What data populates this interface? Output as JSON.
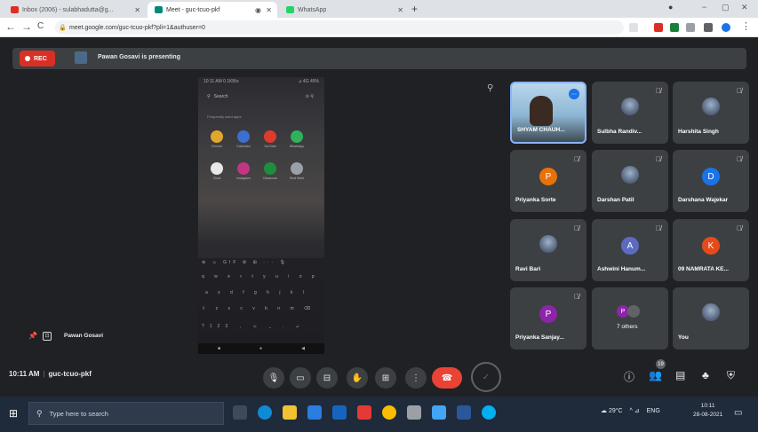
{
  "browser": {
    "tabs": [
      {
        "title": "Inbox (2006) - sulabhadutta@g...",
        "favicon_color": "#d93025"
      },
      {
        "title": "Meet - guc-tcuo-pkf",
        "favicon_color": "#00897b"
      },
      {
        "title": "WhatsApp",
        "favicon_color": "#25d366"
      }
    ],
    "tab_close": "✕",
    "tab_indicator": "◉",
    "new_tab": "+",
    "window_controls": {
      "minimize": "−",
      "restore": "▢",
      "close": "✕"
    },
    "profile": "●",
    "nav": {
      "back": "←",
      "forward": "→",
      "reload": "C"
    },
    "lock": "🔒",
    "url": "meet.google.com/guc-tcuo-pkf?pli=1&authuser=0",
    "extensions": [
      {
        "name": "star",
        "color": "#dee1e6"
      },
      {
        "name": "ext-red",
        "color": "#d93025"
      },
      {
        "name": "ext-check",
        "color": "#188038"
      },
      {
        "name": "ext-grid",
        "color": "#9aa0a6"
      },
      {
        "name": "ext-puzzle",
        "color": "#5f6368"
      },
      {
        "name": "ext-profile",
        "color": "#1a73e8"
      }
    ],
    "menu": "⋮"
  },
  "meet": {
    "rec_label": "REC",
    "presenting_text": "Pawan Gosavi is presenting",
    "pin_icon": "⚲",
    "shared_screen": {
      "status_left": "10:11 AM 0.1KB/s",
      "status_right": "⊿ 4G 45%",
      "search_placeholder": "Search",
      "search_icons": "⊙ ⚲",
      "section": "Frequently used apps",
      "apps_row1": [
        {
          "label": "Chrome",
          "color": "#e0a72a"
        },
        {
          "label": "Calculator",
          "color": "#3b6fd1"
        },
        {
          "label": "YouTube",
          "color": "#e03a2e"
        },
        {
          "label": "WhatsApp",
          "color": "#2fb25b"
        }
      ],
      "apps_row2": [
        {
          "label": "Clock",
          "color": "#e8e8e8"
        },
        {
          "label": "Instagram",
          "color": "#c13584"
        },
        {
          "label": "Classroom",
          "color": "#1e8e3e"
        },
        {
          "label": "Real Meet",
          "color": "#9aa0a6"
        }
      ],
      "keyboard_rows": [
        "q w e r t y u i o p",
        "a s d f g h j k l",
        "⇧ z x c v b n m ⌫",
        "?123 , ☺ ⎵ . ↵"
      ],
      "keyboard_top": "⊕ ☺ GIF ⚙ ⊞ ··· 🎙",
      "navbar": [
        "■",
        "●",
        "◀"
      ]
    },
    "tiles": [
      {
        "name": "SHYAM CHAUH...",
        "type": "camera",
        "muted": false,
        "more": "⋯"
      },
      {
        "name": "Sulbha Randiv...",
        "type": "photo",
        "muted": true
      },
      {
        "name": "Harshita Singh",
        "type": "photo",
        "muted": true
      },
      {
        "name": "Priyanka Sorte",
        "type": "letter",
        "initial": "P",
        "color": "#e8710a",
        "muted": true
      },
      {
        "name": "Darshan Patil",
        "type": "photo",
        "muted": true
      },
      {
        "name": "Darshana Wajekar",
        "type": "letter",
        "initial": "D",
        "color": "#1a73e8",
        "muted": true
      },
      {
        "name": "Ravi Bari",
        "type": "photo",
        "muted": true
      },
      {
        "name": "Ashwini Hanum...",
        "type": "letter",
        "initial": "A",
        "color": "#5c6bc0",
        "muted": true
      },
      {
        "name": "09 NAMRATA KE...",
        "type": "letter",
        "initial": "K",
        "color": "#e64a19",
        "muted": true
      },
      {
        "name": "Priyanka Sanjay...",
        "type": "letter",
        "initial": "P",
        "color": "#8e24aa",
        "muted": true
      },
      {
        "name": "7 others",
        "type": "others",
        "initial": "P",
        "color": "#8e24aa",
        "muted": false
      },
      {
        "name": "You",
        "type": "photo",
        "muted": false
      }
    ],
    "mute_icon": "🎙̸",
    "self_view_name": "Pawan Gosavi",
    "self_pin": "📌",
    "self_box": "⊡",
    "time": "10:11 AM",
    "meeting_code": "guc-tcuo-pkf",
    "controls": [
      {
        "name": "mic-button",
        "icon": "🎙"
      },
      {
        "name": "camera-button",
        "icon": "▭"
      },
      {
        "name": "captions-button",
        "icon": "⊟"
      },
      {
        "name": "raise-hand-button",
        "icon": "✋"
      },
      {
        "name": "present-button",
        "icon": "⊞"
      },
      {
        "name": "more-options-button",
        "icon": "⋮"
      }
    ],
    "end_call_icon": "☎",
    "activity_icon": "✓",
    "right_controls": [
      {
        "name": "meeting-info-button",
        "icon": "ⓘ"
      },
      {
        "name": "people-button",
        "icon": "👥"
      },
      {
        "name": "chat-button",
        "icon": "▤"
      },
      {
        "name": "activities-button",
        "icon": "♣"
      },
      {
        "name": "host-controls-button",
        "icon": "⛨"
      }
    ],
    "people_count": "19"
  },
  "taskbar": {
    "start_icon": "⊞",
    "search_placeholder": "Type here to search",
    "search_icon": "⚲",
    "apps": [
      {
        "name": "task-view",
        "color": "#3e4a5c"
      },
      {
        "name": "edge",
        "color": "#0f8ad6"
      },
      {
        "name": "file-explorer",
        "color": "#f1c232"
      },
      {
        "name": "store",
        "color": "#2a7de1"
      },
      {
        "name": "mail",
        "color": "#1565c0"
      },
      {
        "name": "app-red",
        "color": "#e53935"
      },
      {
        "name": "chrome",
        "color": "#fbbc04"
      },
      {
        "name": "settings",
        "color": "#9aa0a6"
      },
      {
        "name": "app-blue",
        "color": "#42a5f5"
      },
      {
        "name": "word",
        "color": "#2b579a"
      },
      {
        "name": "app-circle",
        "color": "#00b0f0"
      }
    ],
    "weather": "☁ 29°C",
    "tray_icons": "^ ⊿",
    "language": "ENG",
    "time": "10:11",
    "date": "28-08-2021",
    "notifications_icon": "▭"
  }
}
